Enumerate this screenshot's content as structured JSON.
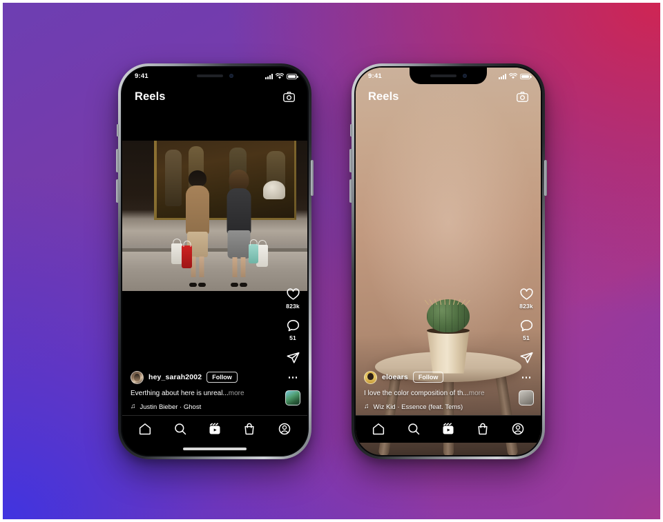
{
  "background": {
    "gradient_colors": [
      "#6d3eb2",
      "#cf2553",
      "#a63a93",
      "#4034e0"
    ],
    "frame_color": "#ffffff"
  },
  "phones": [
    {
      "id": "phone-left",
      "status_bar": {
        "time": "9:41",
        "signal_icon": "cellular-signal-icon",
        "wifi_icon": "wifi-icon",
        "battery_icon": "battery-icon"
      },
      "header": {
        "title": "Reels",
        "camera_icon": "camera-icon"
      },
      "media": {
        "type": "photo",
        "description": "Two women with shopping bags facing a storefront window",
        "background_color": "#000000"
      },
      "actions": {
        "like": {
          "icon": "heart-icon",
          "count": "823k"
        },
        "comment": {
          "icon": "comment-icon",
          "count": "51"
        },
        "share": {
          "icon": "share-icon",
          "count": ""
        },
        "more": {
          "icon": "more-options-icon"
        },
        "audio_thumbnail": {
          "icon": "audio-thumbnail-icon"
        }
      },
      "caption": {
        "avatar": "user-avatar",
        "username": "hey_sarah2002",
        "follow_label": "Follow",
        "text": "Everthing about here is unreal...",
        "more_label": "more",
        "music_icon": "music-note-icon",
        "audio_title": "Justin Bieber · Ghost"
      },
      "tabbar": {
        "items": [
          {
            "name": "home",
            "icon": "home-icon",
            "active": false
          },
          {
            "name": "search",
            "icon": "search-icon",
            "active": false
          },
          {
            "name": "reels",
            "icon": "reels-icon",
            "active": true
          },
          {
            "name": "shop",
            "icon": "shop-bag-icon",
            "active": false
          },
          {
            "name": "profile",
            "icon": "profile-icon",
            "active": false
          }
        ]
      }
    },
    {
      "id": "phone-right",
      "status_bar": {
        "time": "9:41",
        "signal_icon": "cellular-signal-icon",
        "wifi_icon": "wifi-icon",
        "battery_icon": "battery-icon"
      },
      "header": {
        "title": "Reels",
        "camera_icon": "camera-icon"
      },
      "media": {
        "type": "photo",
        "description": "Potted cactus on a round beige stool against a warm tan backdrop",
        "background_color": "#c29a80"
      },
      "actions": {
        "like": {
          "icon": "heart-icon",
          "count": "823k"
        },
        "comment": {
          "icon": "comment-icon",
          "count": "51"
        },
        "share": {
          "icon": "share-icon",
          "count": ""
        },
        "more": {
          "icon": "more-options-icon"
        },
        "audio_thumbnail": {
          "icon": "audio-thumbnail-icon"
        }
      },
      "caption": {
        "avatar": "user-avatar",
        "username": "eloears",
        "follow_label": "Follow",
        "text": "I love the color composition of th...",
        "more_label": "more",
        "music_icon": "music-note-icon",
        "audio_title": "Wiz Kid · Essence (feat. Tems)"
      },
      "tabbar": {
        "items": [
          {
            "name": "home",
            "icon": "home-icon",
            "active": false
          },
          {
            "name": "search",
            "icon": "search-icon",
            "active": false
          },
          {
            "name": "reels",
            "icon": "reels-icon",
            "active": true
          },
          {
            "name": "shop",
            "icon": "shop-bag-icon",
            "active": false
          },
          {
            "name": "profile",
            "icon": "profile-icon",
            "active": false
          }
        ]
      }
    }
  ]
}
